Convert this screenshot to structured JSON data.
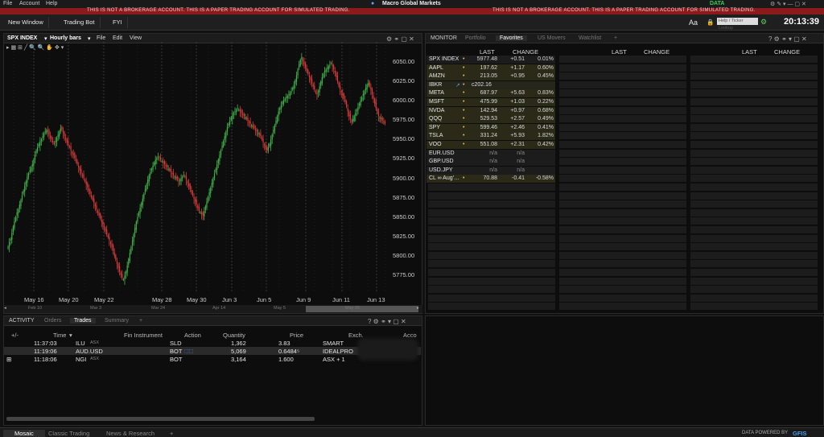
{
  "menubar": {
    "items": [
      "File",
      "Account",
      "Help"
    ],
    "title": "Macro Global Markets",
    "data_badge": "DATA"
  },
  "banner": {
    "left": "THIS IS NOT A BROKERAGE ACCOUNT. THIS IS A PAPER TRADING ACCOUNT FOR SIMULATED TRADING.",
    "right": "THIS IS NOT A BROKERAGE ACCOUNT. THIS IS A PAPER TRADING ACCOUNT FOR SIMULATED TRADING."
  },
  "appbar": {
    "new_window": "New Window",
    "trading_bot": "Trading Bot",
    "fyi": "FYI",
    "font_btn": "Aa",
    "ticker_placeholder": "Help / Ticker Lookup",
    "clock": "20:13:39"
  },
  "chart": {
    "symbol": "SPX INDEX",
    "interval": "Hourly bars",
    "menu_file": "File",
    "menu_edit": "Edit",
    "menu_view": "View",
    "yticks": [
      "6050.00",
      "6025.00",
      "6000.00",
      "5975.00",
      "5950.00",
      "5925.00",
      "5900.00",
      "5875.00",
      "5850.00",
      "5825.00",
      "5800.00",
      "5775.00"
    ],
    "xticks": [
      "May 16",
      "May 20",
      "May 22",
      "May 28",
      "May 30",
      "Jun 3",
      "Jun 5",
      "Jun 9",
      "Jun 11",
      "Jun 13"
    ],
    "nav_ticks": [
      "Feb 10",
      "Mar 3",
      "Mar 24",
      "Apr 14",
      "May 5",
      "May 26"
    ]
  },
  "chart_data": {
    "type": "candlestick",
    "ylim": [
      5765,
      6065
    ],
    "closes": [
      5812,
      5818,
      5822,
      5830,
      5838,
      5845,
      5850,
      5856,
      5860,
      5866,
      5872,
      5878,
      5884,
      5890,
      5896,
      5902,
      5906,
      5910,
      5914,
      5918,
      5924,
      5930,
      5936,
      5940,
      5944,
      5948,
      5950,
      5954,
      5958,
      5960,
      5962,
      5960,
      5956,
      5952,
      5950,
      5946,
      5944,
      5948,
      5952,
      5956,
      5960,
      5964,
      5962,
      5958,
      5954,
      5950,
      5946,
      5942,
      5940,
      5936,
      5932,
      5930,
      5926,
      5922,
      5918,
      5914,
      5910,
      5906,
      5904,
      5900,
      5896,
      5892,
      5888,
      5884,
      5880,
      5876,
      5872,
      5868,
      5864,
      5860,
      5856,
      5852,
      5848,
      5844,
      5840,
      5836,
      5832,
      5828,
      5824,
      5820,
      5816,
      5812,
      5806,
      5800,
      5795,
      5790,
      5785,
      5780,
      5776,
      5772,
      5770,
      5775,
      5780,
      5788,
      5796,
      5804,
      5812,
      5820,
      5828,
      5836,
      5844,
      5850,
      5856,
      5862,
      5868,
      5874,
      5880,
      5886,
      5892,
      5898,
      5904,
      5908,
      5912,
      5916,
      5920,
      5924,
      5926,
      5928,
      5926,
      5924,
      5922,
      5920,
      5918,
      5916,
      5914,
      5912,
      5910,
      5908,
      5906,
      5904,
      5902,
      5900,
      5898,
      5896,
      5898,
      5900,
      5902,
      5904,
      5902,
      5898,
      5894,
      5890,
      5886,
      5882,
      5878,
      5874,
      5870,
      5866,
      5862,
      5858,
      5856,
      5854,
      5852,
      5858,
      5864,
      5870,
      5876,
      5882,
      5888,
      5894,
      5900,
      5906,
      5912,
      5918,
      5924,
      5930,
      5936,
      5942,
      5948,
      5954,
      5960,
      5966,
      5970,
      5974,
      5978,
      5982,
      5984,
      5986,
      5988,
      5990,
      5988,
      5986,
      5984,
      5982,
      5980,
      5978,
      5976,
      5974,
      5972,
      5970,
      5968,
      5966,
      5964,
      5962,
      5960,
      5958,
      5956,
      5954,
      5950,
      5946,
      5942,
      5938,
      5936,
      5940,
      5944,
      5950,
      5956,
      5962,
      5968,
      5974,
      5980,
      5986,
      5990,
      5994,
      5998,
      6000,
      6002,
      6004,
      6006,
      6008,
      6010,
      6012,
      6016,
      6020,
      6026,
      6032,
      6040,
      6046,
      6052,
      6056,
      6050,
      6046,
      6042,
      6038,
      6034,
      6030,
      6026,
      6022,
      6018,
      6014,
      6010,
      6008,
      6012,
      6018,
      6024,
      6030,
      6034,
      6038,
      6040,
      6042,
      6044,
      6046,
      6048,
      6044,
      6040,
      6036,
      6030,
      6024,
      6018,
      6014,
      6010,
      6006,
      6002,
      5998,
      5992,
      5986,
      5980,
      5976,
      5972,
      5976,
      5980,
      5984,
      5988,
      5992,
      5996,
      6000,
      6004,
      6008,
      6012,
      6016,
      6020,
      6022,
      6018,
      6014,
      6008,
      6002,
      5996,
      5990,
      5984,
      5980,
      5978,
      5976,
      5974,
      5972,
      5970
    ]
  },
  "monitor": {
    "tabs": [
      "MONITOR",
      "Portfolio",
      "Favorites",
      "US Movers",
      "Watchlist",
      "+"
    ],
    "col_last": "LAST",
    "col_change": "CHANGE",
    "rows": [
      {
        "sym": "SPX INDEX",
        "last": "5977.48",
        "chg": "+0.51",
        "pct": "0.01%"
      },
      {
        "sym": "AAPL",
        "last": "197.62",
        "chg": "+1.17",
        "pct": "0.60%"
      },
      {
        "sym": "AMZN",
        "last": "213.05",
        "chg": "+0.95",
        "pct": "0.45%"
      },
      {
        "sym": "IBKR",
        "last": "c202.16",
        "chg": "",
        "pct": ""
      },
      {
        "sym": "META",
        "last": "687.97",
        "chg": "+5.63",
        "pct": "0.83%"
      },
      {
        "sym": "MSFT",
        "last": "475.99",
        "chg": "+1.03",
        "pct": "0.22%"
      },
      {
        "sym": "NVDA",
        "last": "142.94",
        "chg": "+0.97",
        "pct": "0.68%"
      },
      {
        "sym": "QQQ",
        "last": "529.53",
        "chg": "+2.57",
        "pct": "0.49%"
      },
      {
        "sym": "SPY",
        "last": "599.46",
        "chg": "+2.46",
        "pct": "0.41%"
      },
      {
        "sym": "TSLA",
        "last": "331.24",
        "chg": "+5.93",
        "pct": "1.82%"
      },
      {
        "sym": "VOO",
        "last": "551.08",
        "chg": "+2.31",
        "pct": "0.42%"
      },
      {
        "sym": "EUR.USD",
        "last": "n/a",
        "chg": "n/a",
        "pct": ""
      },
      {
        "sym": "GBP.USD",
        "last": "n/a",
        "chg": "n/a",
        "pct": ""
      },
      {
        "sym": "USD.JPY",
        "last": "n/a",
        "chg": "n/a",
        "pct": ""
      },
      {
        "sym": "CL ∞ Aug'…",
        "last": "70.88",
        "chg": "-0.41",
        "pct": "-0.58%"
      }
    ]
  },
  "activity": {
    "tabs": [
      "ACTIVITY",
      "Orders",
      "Trades",
      "Summary",
      "+"
    ],
    "headers": {
      "plusminus": "+/-",
      "time": "Time",
      "instrument": "Fin Instrument",
      "action": "Action",
      "qty": "Quantity",
      "price": "Price",
      "exch": "Exch.",
      "acct": "Acco"
    },
    "rows": [
      {
        "time": "11:37:03",
        "sym": "ILU",
        "sub": "ASX",
        "action": "SLD",
        "qty": "1,362",
        "price": "3.83",
        "exch": "SMART"
      },
      {
        "time": "11:19:06",
        "sym": "AUD.USD",
        "sub": "",
        "action": "BOT",
        "qty": "5,069",
        "price": "0.6484⁵",
        "exch": "IDEALPRO"
      },
      {
        "time": "11:18:06",
        "sym": "NGI",
        "sub": "ASX",
        "action": "BOT",
        "qty": "3,164",
        "price": "1.600",
        "exch": "ASX + 1"
      }
    ]
  },
  "bottom": {
    "tabs": [
      "Mosaic",
      "Classic Trading",
      "News & Research",
      "+"
    ],
    "powered": "DATA POWERED BY",
    "gfis": "GFIS"
  }
}
